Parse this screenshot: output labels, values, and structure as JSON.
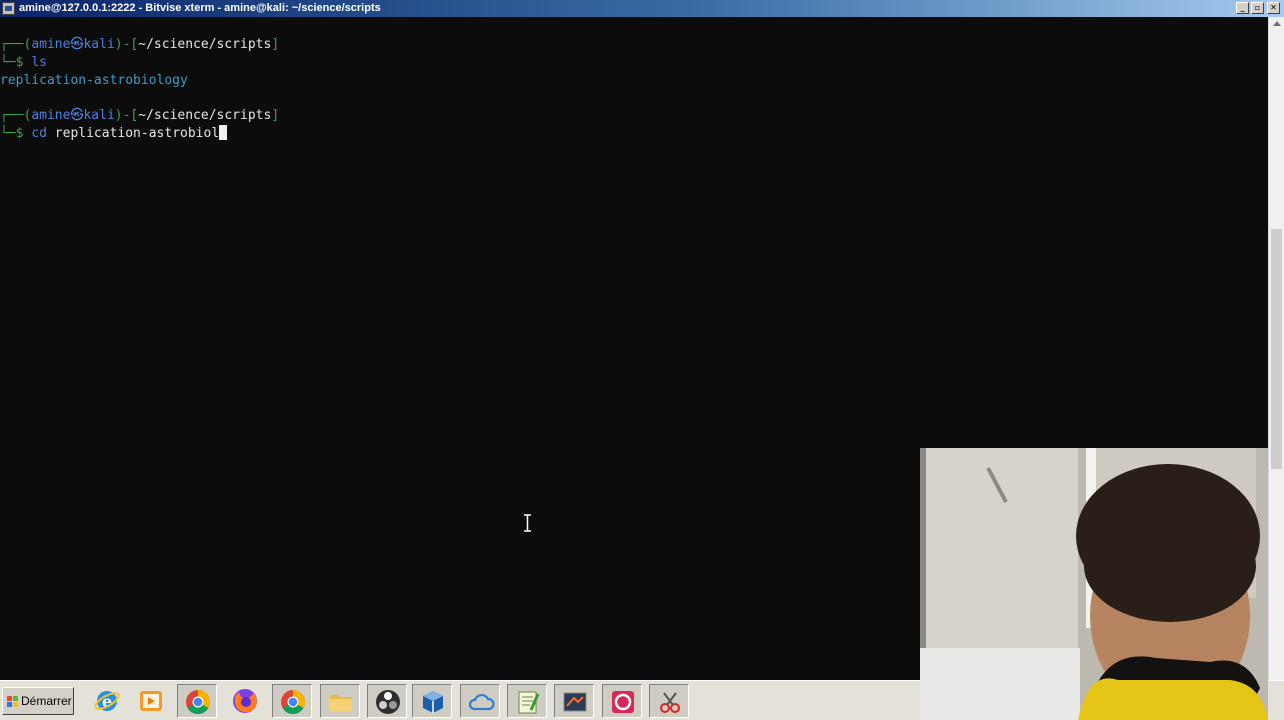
{
  "window": {
    "title": "amine@127.0.0.1:2222 - Bitvise xterm - amine@kali: ~/science/scripts",
    "minimize": "_",
    "restore": "▫",
    "close": "✕"
  },
  "terminal": {
    "block1": {
      "prompt_open": "┌──(",
      "user": "amine",
      "at": "㉿",
      "host": "kali",
      "prompt_mid": ")-[",
      "path": "~/science/scripts",
      "prompt_close": "]",
      "cmd_prefix": "└─$ ",
      "command": "ls"
    },
    "output": "replication-astrobiology",
    "block2": {
      "prompt_open": "┌──(",
      "user": "amine",
      "at": "㉿",
      "host": "kali",
      "prompt_mid": ")-[",
      "path": "~/science/scripts",
      "prompt_close": "]",
      "cmd_prefix": "└─$ ",
      "cmd": "cd",
      "argument": " replication-astrobiol"
    }
  },
  "taskbar": {
    "start_label": "Démarrer",
    "items": [
      "internet-explorer-icon",
      "media-player-icon",
      "chrome-icon",
      "firefox-icon",
      "chrome-icon",
      "file-explorer-icon",
      "obs-icon",
      "virtualbox-icon",
      "cloud-icon",
      "notepad-icon",
      "bitvise-terminal-icon",
      "screen-recorder-icon",
      "snipping-tool-icon"
    ]
  },
  "colors": {
    "terminal_bg": "#0c0c0c",
    "prompt_green": "#3fa34d",
    "prompt_blue": "#4f7fdc",
    "titlebar_blue": "#0a246a"
  }
}
